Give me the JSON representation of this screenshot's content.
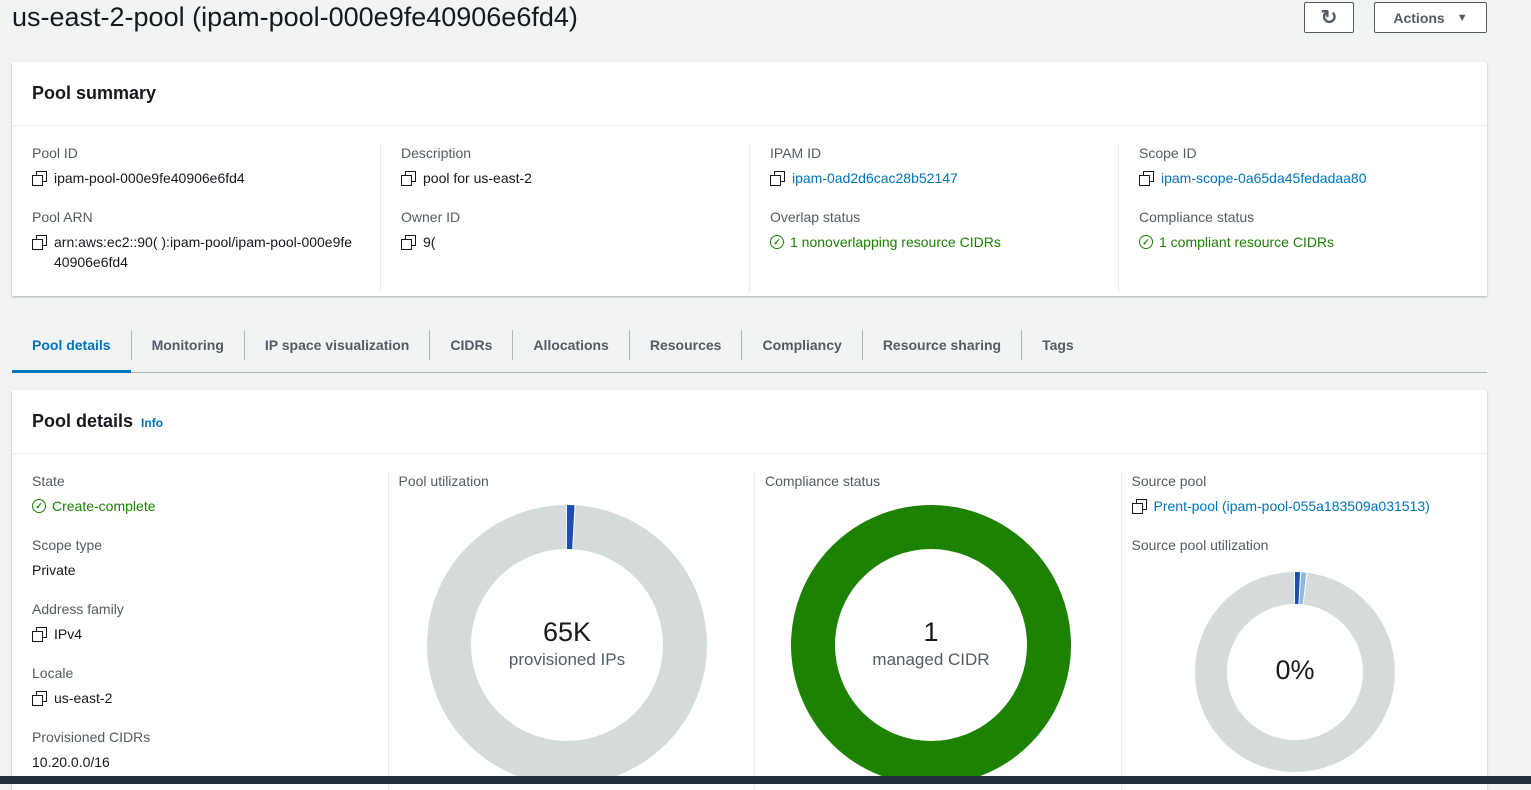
{
  "header": {
    "title": "us-east-2-pool (ipam-pool-000e9fe40906e6fd4)",
    "refresh_icon": "refresh-icon",
    "actions_label": "Actions"
  },
  "summary": {
    "title": "Pool summary",
    "pool_id": {
      "label": "Pool ID",
      "value": "ipam-pool-000e9fe40906e6fd4"
    },
    "pool_arn": {
      "label": "Pool ARN",
      "value": "arn:aws:ec2::90(               ):ipam-pool/ipam-pool-000e9fe40906e6fd4"
    },
    "description": {
      "label": "Description",
      "value": "pool for us-east-2"
    },
    "owner_id": {
      "label": "Owner ID",
      "value": "9("
    },
    "ipam_id": {
      "label": "IPAM ID",
      "value": "ipam-0ad2d6cac28b52147"
    },
    "overlap": {
      "label": "Overlap status",
      "value": "1 nonoverlapping resource CIDRs"
    },
    "scope_id": {
      "label": "Scope ID",
      "value": "ipam-scope-0a65da45fedadaa80"
    },
    "compliance": {
      "label": "Compliance status",
      "value": "1 compliant resource CIDRs"
    }
  },
  "tabs": [
    {
      "label": "Pool details",
      "active": true
    },
    {
      "label": "Monitoring"
    },
    {
      "label": "IP space visualization"
    },
    {
      "label": "CIDRs"
    },
    {
      "label": "Allocations"
    },
    {
      "label": "Resources"
    },
    {
      "label": "Compliancy"
    },
    {
      "label": "Resource sharing"
    },
    {
      "label": "Tags"
    }
  ],
  "details": {
    "title": "Pool details",
    "info": "Info",
    "state": {
      "label": "State",
      "value": "Create-complete"
    },
    "scope_type": {
      "label": "Scope type",
      "value": "Private"
    },
    "address_family": {
      "label": "Address family",
      "value": "IPv4"
    },
    "locale": {
      "label": "Locale",
      "value": "us-east-2"
    },
    "provisioned": {
      "label": "Provisioned CIDRs",
      "value": "10.20.0.0/16"
    },
    "utilization": {
      "label": "Pool utilization",
      "big": "65K",
      "small": "provisioned IPs"
    },
    "compliance": {
      "label": "Compliance status",
      "big": "1",
      "small": "managed CIDR"
    },
    "source_pool": {
      "label": "Source pool",
      "value": "Prent-pool (ipam-pool-055a183509a031513)"
    },
    "source_util": {
      "label": "Source pool utilization",
      "big": "0%"
    }
  },
  "chart_data": [
    {
      "type": "pie",
      "name_shown": "Pool utilization",
      "slices": [
        {
          "value": 1,
          "color": "#1f4db4"
        },
        {
          "value": 99,
          "color": "#d5dbdb"
        }
      ]
    },
    {
      "type": "pie",
      "name_shown": "Compliance status",
      "slices": [
        {
          "value": 100,
          "color": "#1d8102"
        }
      ]
    },
    {
      "type": "pie",
      "name_shown": "Source pool utilization",
      "slices": [
        {
          "value": 1,
          "color": "#1f4db4"
        },
        {
          "value": 1,
          "color": "#8fb8e0"
        },
        {
          "value": 98,
          "color": "#d5dbdb"
        }
      ]
    }
  ]
}
